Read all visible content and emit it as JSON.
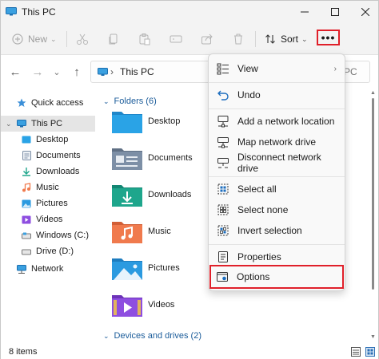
{
  "window": {
    "title": "This PC",
    "controls": {
      "minimize": "—",
      "maximize": "☐",
      "close": "✕"
    }
  },
  "toolbar": {
    "new_label": "New",
    "sort_label": "Sort",
    "more_label": "•••",
    "icons": [
      "cut-icon",
      "copy-icon",
      "paste-icon",
      "rename-icon",
      "share-icon",
      "delete-icon"
    ]
  },
  "navigation": {
    "breadcrumb": "This PC",
    "breadcrumb_tail": "PC"
  },
  "sidebar": {
    "items": [
      {
        "label": "Quick access",
        "icon": "star-icon"
      },
      {
        "label": "This PC",
        "icon": "pc-icon",
        "selected": true
      },
      {
        "label": "Desktop",
        "icon": "desktop-icon"
      },
      {
        "label": "Documents",
        "icon": "documents-icon"
      },
      {
        "label": "Downloads",
        "icon": "downloads-icon"
      },
      {
        "label": "Music",
        "icon": "music-icon"
      },
      {
        "label": "Pictures",
        "icon": "pictures-icon"
      },
      {
        "label": "Videos",
        "icon": "videos-icon"
      },
      {
        "label": "Windows (C:)",
        "icon": "drive-icon"
      },
      {
        "label": "Drive (D:)",
        "icon": "drive-icon"
      },
      {
        "label": "Network",
        "icon": "network-icon"
      }
    ]
  },
  "main": {
    "folders_header": "Folders (6)",
    "folders": [
      {
        "name": "Desktop",
        "color": "#2aa3e6"
      },
      {
        "name": "Documents",
        "color": "#7d8fa6"
      },
      {
        "name": "Downloads",
        "color": "#1ea68c"
      },
      {
        "name": "Music",
        "color": "#f07a4d"
      },
      {
        "name": "Pictures",
        "color": "#2b9ae0"
      },
      {
        "name": "Videos",
        "color": "#8e4ee0"
      }
    ],
    "devices_header": "Devices and drives (2)"
  },
  "status": {
    "item_count": "8 items"
  },
  "menu": {
    "items": [
      {
        "label": "View",
        "icon": "view-icon",
        "has_submenu": true
      },
      {
        "label": "Undo",
        "icon": "undo-icon"
      },
      {
        "label": "Add a network location",
        "icon": "network-location-icon"
      },
      {
        "label": "Map network drive",
        "icon": "map-drive-icon"
      },
      {
        "label": "Disconnect network drive",
        "icon": "disconnect-drive-icon"
      },
      {
        "label": "Select all",
        "icon": "select-all-icon"
      },
      {
        "label": "Select none",
        "icon": "select-none-icon"
      },
      {
        "label": "Invert selection",
        "icon": "invert-selection-icon"
      },
      {
        "label": "Properties",
        "icon": "properties-icon"
      },
      {
        "label": "Options",
        "icon": "options-icon",
        "highlighted": true
      }
    ]
  },
  "colors": {
    "accent": "#0067c0",
    "highlight_border": "#e0202a",
    "group_header": "#1b5c9a"
  }
}
